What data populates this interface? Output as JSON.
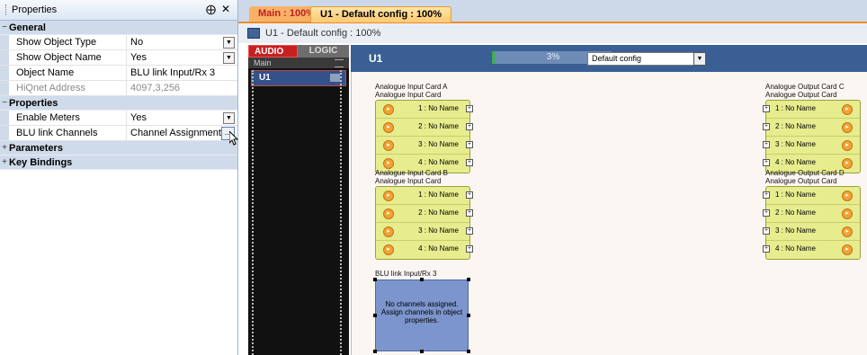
{
  "properties": {
    "title": "Properties",
    "pin_glyph": "⨁",
    "close_glyph": "✕",
    "categories": {
      "general": "General",
      "properties": "Properties",
      "parameters": "Parameters",
      "key_bindings": "Key Bindings"
    },
    "general_rows": [
      {
        "name": "Show Object Type",
        "value": "No"
      },
      {
        "name": "Show Object Name",
        "value": "Yes"
      },
      {
        "name": "Object Name",
        "value": "BLU link Input/Rx 3"
      },
      {
        "name": "HiQnet Address",
        "value": "4097,3,256"
      }
    ],
    "properties_rows": [
      {
        "name": "Enable Meters",
        "value": "Yes"
      },
      {
        "name": "BLU link Channels",
        "value": "Channel Assignment"
      }
    ],
    "ellipsis": "...",
    "toggle_open": "−",
    "toggle_closed": "+"
  },
  "tabs": {
    "inactive": "Main : 100%",
    "active": "U1 - Default config : 100%"
  },
  "doc": {
    "title": "U1 - Default config : 100%"
  },
  "strip": {
    "audio": "AUDIO",
    "logic": "LOGIC",
    "main": "Main",
    "u1": "U1"
  },
  "canvas_header": {
    "device": "U1",
    "meter_text": "3%",
    "meter_value": 0.03,
    "config": "Default config"
  },
  "cards": {
    "input_a": {
      "title": "Analogue Input Card A",
      "subtitle": "Analogue Input Card",
      "channels": [
        "1 : No Name",
        "2 : No Name",
        "3 : No Name",
        "4 : No Name"
      ]
    },
    "input_b": {
      "title": "Analogue Input Card B",
      "subtitle": "Analogue Input Card",
      "channels": [
        "1 : No Name",
        "2 : No Name",
        "3 : No Name",
        "4 : No Name"
      ]
    },
    "output_c": {
      "title": "Analogue Output Card C",
      "subtitle": "Analogue Output Card",
      "channels": [
        "1 : No Name",
        "2 : No Name",
        "3 : No Name",
        "4 : No Name"
      ]
    },
    "output_d": {
      "title": "Analogue Output Card D",
      "subtitle": "Analogue Output Card",
      "channels": [
        "1 : No Name",
        "2 : No Name",
        "3 : No Name",
        "4 : No Name"
      ]
    }
  },
  "blu": {
    "title": "BLU link Input/Rx 3",
    "message_lines": [
      "No channels assigned.",
      "Assign channels in object",
      "properties."
    ]
  }
}
